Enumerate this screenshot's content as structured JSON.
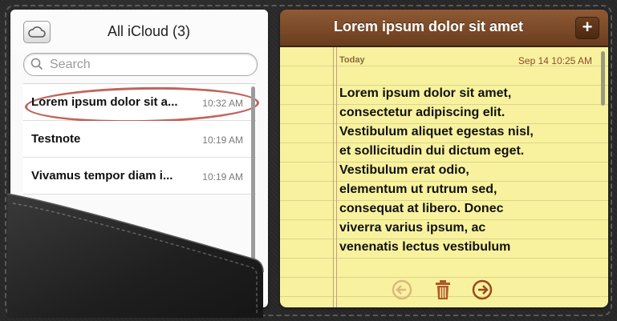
{
  "list": {
    "title": "All iCloud (3)",
    "search_placeholder": "Search",
    "notes": [
      {
        "title": "Lorem ipsum dolor sit a...",
        "time": "10:32 AM"
      },
      {
        "title": "Testnote",
        "time": "10:19 AM"
      },
      {
        "title": "Vivamus tempor diam i...",
        "time": "10:19 AM"
      }
    ]
  },
  "note": {
    "title": "Lorem ipsum dolor sit amet",
    "day": "Today",
    "datetime": "Sep 14  10:25 AM",
    "body_lines": [
      "Lorem ipsum dolor sit amet,",
      "consectetur adipiscing elit.",
      "Vestibulum aliquet egestas nisl,",
      "et sollicitudin dui dictum eget.",
      "Vestibulum erat odio,",
      "elementum ut rutrum sed,",
      "consequat at libero. Donec",
      "viverra varius ipsum, ac",
      "venenatis lectus vestibulum"
    ],
    "add_label": "+"
  },
  "icons": [
    "cloud-icon",
    "search-icon",
    "add-icon",
    "back-arrow-icon",
    "trash-icon",
    "forward-arrow-icon"
  ],
  "colors": {
    "header_brown": "#7b4a28",
    "paper_yellow": "#f8f29e",
    "circle_mark": "#aa3228",
    "leather": "#282828"
  }
}
